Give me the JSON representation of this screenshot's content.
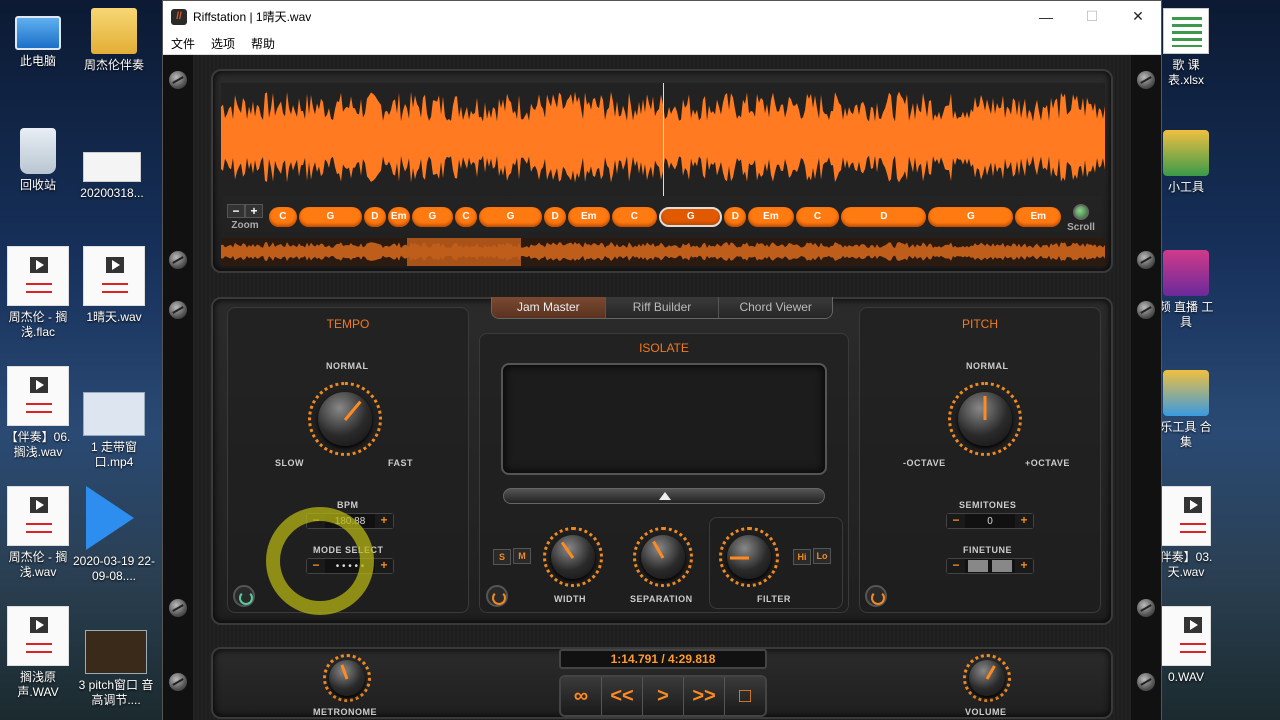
{
  "desktop": {
    "left_icons": [
      {
        "label": "此电脑"
      },
      {
        "label": "周杰伦伴奏"
      },
      {
        "label": "回收站"
      },
      {
        "label": "20200318..."
      },
      {
        "label": "周杰伦 - 搁浅.flac"
      },
      {
        "label": "1晴天.wav"
      },
      {
        "label": "【伴奏】06.搁浅.wav"
      },
      {
        "label": "1 走带窗口.mp4"
      },
      {
        "label": "周杰伦 - 搁浅.wav"
      },
      {
        "label": "2020-03-19 22-09-08...."
      },
      {
        "label": "搁浅原声.WAV"
      },
      {
        "label": "3 pitch窗口 音高调节...."
      }
    ],
    "right_icons": [
      {
        "label": "歌 课表.xlsx"
      },
      {
        "label": "小工具"
      },
      {
        "label": "频 直播 工具"
      },
      {
        "label": "乐工具 合集"
      },
      {
        "label": "伴奏】03.天.wav"
      },
      {
        "label": "0.WAV"
      }
    ]
  },
  "window": {
    "title": "Riffstation | 1晴天.wav",
    "app_icon": "//",
    "minimize": "—",
    "maximize": "☐",
    "close": "✕",
    "menu": [
      "文件",
      "选项",
      "帮助"
    ]
  },
  "waveform": {
    "color": "#ff7a20",
    "zoom_label": "Zoom",
    "scroll_label": "Scroll",
    "minus": "−",
    "plus": "+",
    "chords": [
      {
        "name": "C"
      },
      {
        "name": "G"
      },
      {
        "name": "D"
      },
      {
        "name": "Em"
      },
      {
        "name": "G"
      },
      {
        "name": "C"
      },
      {
        "name": "G"
      },
      {
        "name": "D"
      },
      {
        "name": "Em"
      },
      {
        "name": "C"
      },
      {
        "name": "G",
        "selected": true
      },
      {
        "name": "D"
      },
      {
        "name": "Em"
      },
      {
        "name": "C"
      },
      {
        "name": "D"
      },
      {
        "name": "G"
      },
      {
        "name": "Em"
      }
    ]
  },
  "tabs": [
    "Jam Master",
    "Riff Builder",
    "Chord Viewer"
  ],
  "tempo": {
    "title": "TEMPO",
    "normal": "NORMAL",
    "slow": "SLOW",
    "fast": "FAST",
    "bpm_label": "BPM",
    "bpm_value": "180.88",
    "mode_label": "MODE SELECT",
    "mode_value": "• • • • •",
    "minus": "−",
    "plus": "+"
  },
  "isolate": {
    "title": "ISOLATE",
    "s": "S",
    "m": "M",
    "hi": "Hi",
    "lo": "Lo",
    "width_label": "WIDTH",
    "separation_label": "SEPARATION",
    "filter_label": "FILTER"
  },
  "pitch": {
    "title": "PITCH",
    "normal": "NORMAL",
    "minus_octave": "-OCTAVE",
    "plus_octave": "+OCTAVE",
    "semitones_label": "SEMITONES",
    "semitones_value": "0",
    "finetune_label": "FINETUNE",
    "minus": "−",
    "plus": "+"
  },
  "transport": {
    "time": "1:14.791 / 4:29.818",
    "loop": "∞",
    "rewind": "<<",
    "play": ">",
    "forward": ">>",
    "stop": "□",
    "metronome_label": "METRONOME",
    "volume_label": "VOLUME"
  }
}
